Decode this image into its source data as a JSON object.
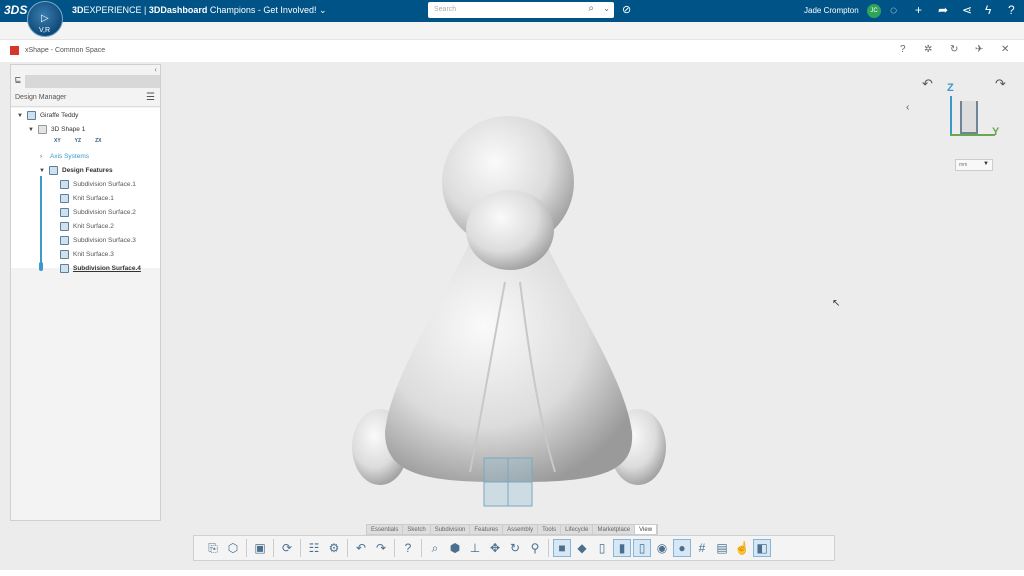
{
  "topbar": {
    "brand_bold": "3D",
    "brand_rest": "EXPERIENCE | ",
    "app": "3DDashboard",
    "dashboard": "Champions - Get Involved!",
    "search_placeholder": "Search",
    "user": "Jade Crompton",
    "initials": "JC",
    "compass_label": "V,R"
  },
  "window": {
    "title": "xShape - Common Space"
  },
  "panel": {
    "title": "Design Manager",
    "tree": [
      {
        "label": "Giraffe Teddy",
        "level": 0
      },
      {
        "label": "3D Shape 1",
        "level": 1
      },
      {
        "label": "Axis Systems",
        "level": 2
      },
      {
        "label": "Design Features",
        "level": 2
      },
      {
        "label": "Subdivision Surface.1",
        "level": 3
      },
      {
        "label": "Knit Surface.1",
        "level": 3
      },
      {
        "label": "Subdivision Surface.2",
        "level": 3
      },
      {
        "label": "Knit Surface.2",
        "level": 3
      },
      {
        "label": "Subdivision Surface.3",
        "level": 3
      },
      {
        "label": "Knit Surface.3",
        "level": 3
      },
      {
        "label": "Subdivision Surface.4",
        "level": 3
      }
    ],
    "planes": [
      "XY",
      "YZ",
      "ZX"
    ]
  },
  "navigator": {
    "z": "Z",
    "y": "Y",
    "units": "mm"
  },
  "tabs": [
    "Essentials",
    "Sketch",
    "Subdivision",
    "Features",
    "Assembly",
    "Tools",
    "Lifecycle",
    "Marketplace",
    "View"
  ],
  "active_tab": "View",
  "toolbar": [
    "insert-icon",
    "part-icon",
    "save-icon",
    "update-icon",
    "properties-icon",
    "settings-icon",
    "undo-icon",
    "redo-icon",
    "help-icon",
    "zoom-area-icon",
    "view-cube-icon",
    "ground-icon",
    "pan-icon",
    "rotate-icon",
    "zoom-icon",
    "shaded-edges-icon",
    "shaded-icon",
    "wireframe-icon",
    "shaded-hidden-icon",
    "hidden-lines-icon",
    "visibility-icon",
    "ambient-icon",
    "grid-icon",
    "capture-icon",
    "select-icon",
    "display-icon"
  ],
  "colors": {
    "topbar": "#005386",
    "accent": "#3a9ac8",
    "avatar": "#2fa35a"
  }
}
